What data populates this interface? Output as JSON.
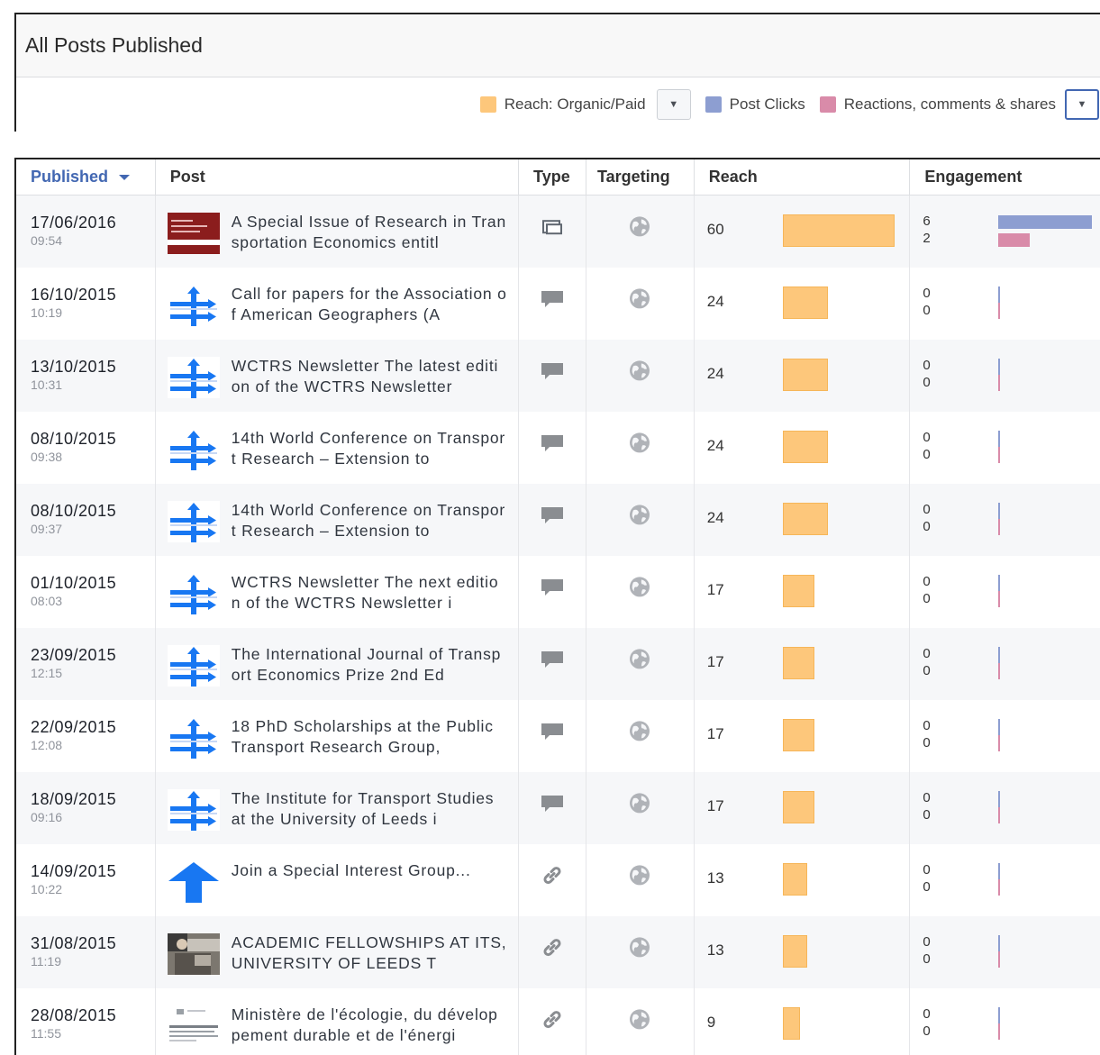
{
  "header": {
    "title": "All Posts Published",
    "legend": [
      {
        "label": "Reach: Organic/Paid",
        "color": "#fdc77b"
      },
      {
        "label": "Post Clicks",
        "color": "#8d9ed1"
      },
      {
        "label": "Reactions, comments & shares",
        "color": "#d98ba9"
      }
    ]
  },
  "table": {
    "columns": {
      "published": "Published",
      "post": "Post",
      "type": "Type",
      "targeting": "Targeting",
      "reach": "Reach",
      "engagement": "Engagement"
    },
    "reach_max": 60,
    "clicks_max": 6,
    "rows": [
      {
        "date": "17/06/2016",
        "time": "09:54",
        "thumb": "journal-cover-thumb",
        "text": "A Special Issue of Research in Transportation Economics entitl",
        "type_icon": "album-icon",
        "reach": 60,
        "clicks": 6,
        "reactions": 2
      },
      {
        "date": "16/10/2015",
        "time": "10:19",
        "thumb": "wctrs-logo-thumb",
        "text": "Call for papers for the Association of American Geographers (A",
        "type_icon": "status-icon",
        "reach": 24,
        "clicks": 0,
        "reactions": 0
      },
      {
        "date": "13/10/2015",
        "time": "10:31",
        "thumb": "wctrs-logo-thumb",
        "text": "WCTRS Newsletter The latest edition of the WCTRS Newsletter",
        "type_icon": "status-icon",
        "reach": 24,
        "clicks": 0,
        "reactions": 0
      },
      {
        "date": "08/10/2015",
        "time": "09:38",
        "thumb": "wctrs-logo-thumb",
        "text": "14th World Conference on Transport Research – Extension to",
        "type_icon": "status-icon",
        "reach": 24,
        "clicks": 0,
        "reactions": 0
      },
      {
        "date": "08/10/2015",
        "time": "09:37",
        "thumb": "wctrs-logo-thumb",
        "text": "14th World Conference on Transport Research – Extension to",
        "type_icon": "status-icon",
        "reach": 24,
        "clicks": 0,
        "reactions": 0
      },
      {
        "date": "01/10/2015",
        "time": "08:03",
        "thumb": "wctrs-logo-thumb",
        "text": "WCTRS Newsletter The next edition of the WCTRS Newsletter i",
        "type_icon": "status-icon",
        "reach": 17,
        "clicks": 0,
        "reactions": 0
      },
      {
        "date": "23/09/2015",
        "time": "12:15",
        "thumb": "wctrs-logo-thumb",
        "text": "The International Journal of Transport Economics Prize 2nd Ed",
        "type_icon": "status-icon",
        "reach": 17,
        "clicks": 0,
        "reactions": 0
      },
      {
        "date": "22/09/2015",
        "time": "12:08",
        "thumb": "wctrs-logo-thumb",
        "text": "18 PhD Scholarships at the Public Transport Research Group,",
        "type_icon": "status-icon",
        "reach": 17,
        "clicks": 0,
        "reactions": 0
      },
      {
        "date": "18/09/2015",
        "time": "09:16",
        "thumb": "wctrs-logo-thumb",
        "text": "The Institute for Transport Studies at the University of Leeds i",
        "type_icon": "status-icon",
        "reach": 17,
        "clicks": 0,
        "reactions": 0
      },
      {
        "date": "14/09/2015",
        "time": "10:22",
        "thumb": "blue-arrow-thumb",
        "text": "Join a Special Interest Group...",
        "type_icon": "link-icon",
        "reach": 13,
        "clicks": 0,
        "reactions": 0
      },
      {
        "date": "31/08/2015",
        "time": "11:19",
        "thumb": "photo-thumb",
        "text": "ACADEMIC FELLOWSHIPS AT ITS, UNIVERSITY OF LEEDS T",
        "type_icon": "link-icon",
        "reach": 13,
        "clicks": 0,
        "reactions": 0
      },
      {
        "date": "28/08/2015",
        "time": "11:55",
        "thumb": "document-thumb",
        "text": "Ministère de l'écologie, du développement durable et de l'énergi",
        "type_icon": "link-icon",
        "reach": 9,
        "clicks": 0,
        "reactions": 0
      }
    ]
  }
}
